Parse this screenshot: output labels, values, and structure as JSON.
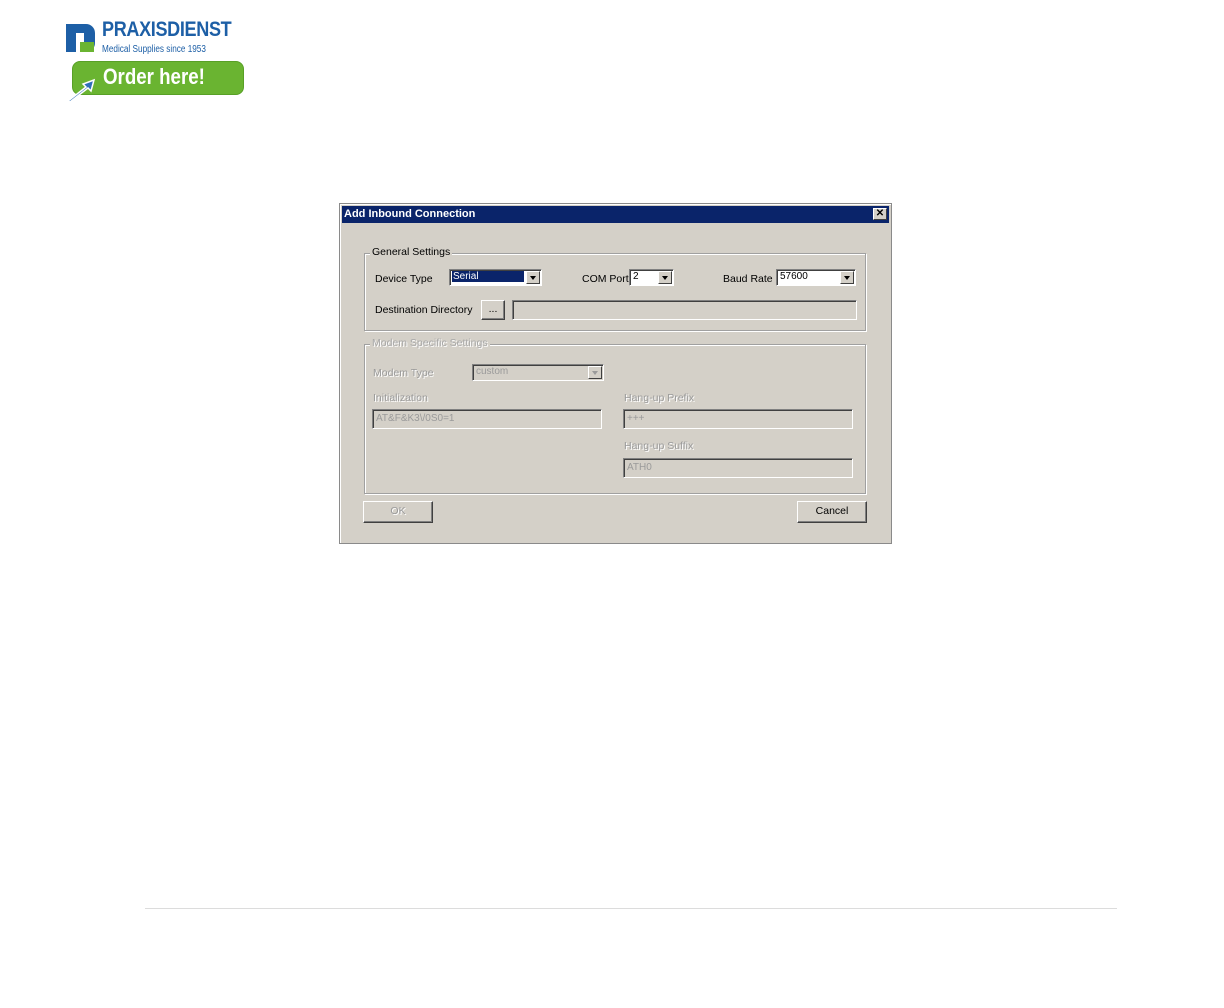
{
  "banner": {
    "brand": "PRAXISDIENST",
    "tagline": "Medical Supplies since 1953",
    "order_label": "Order here!",
    "brand_color": "#1d5fa6",
    "order_color": "#6ab431"
  },
  "dialog": {
    "title": "Add Inbound Connection",
    "close_icon": "close-icon",
    "general": {
      "legend": "General Settings",
      "device_type_label": "Device Type",
      "device_type_value": "Serial",
      "com_port_label": "COM Port",
      "com_port_value": "2",
      "baud_rate_label": "Baud Rate",
      "baud_rate_value": "57600",
      "dest_dir_label": "Destination Directory",
      "browse_label": "...",
      "dest_dir_value": ""
    },
    "modem": {
      "legend": "Modem Specific Settings",
      "modem_type_label": "Modem Type",
      "modem_type_value": "custom",
      "init_label": "Initialization",
      "init_value": "AT&F&K3\\/0S0=1",
      "hangup_prefix_label": "Hang-up Prefix",
      "hangup_prefix_value": "+++",
      "hangup_suffix_label": "Hang-up Suffix",
      "hangup_suffix_value": "ATH0"
    },
    "ok_label": "OK",
    "cancel_label": "Cancel"
  }
}
